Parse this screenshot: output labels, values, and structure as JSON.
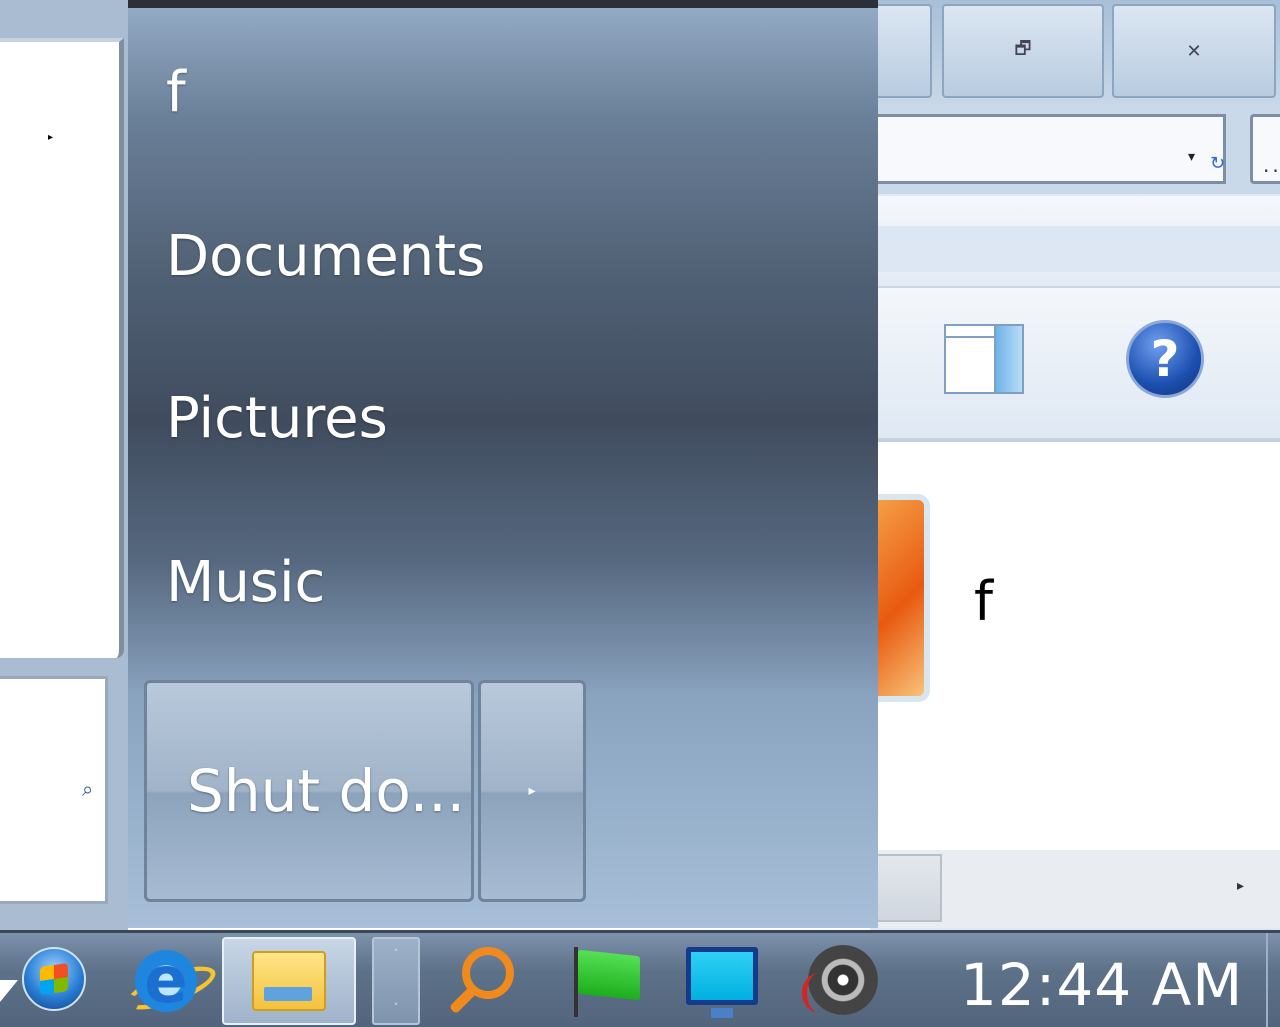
{
  "explorer": {
    "restore_icon": "restore-icon",
    "close_icon": "close-icon",
    "restore_glyph": "🗗",
    "close_glyph": "✕",
    "address_dropdown_glyph": "▾",
    "refresh_glyph": "↻",
    "search_glyph": "..",
    "help_glyph": "?",
    "file_name": "f",
    "scroll_right_glyph": "▸"
  },
  "start_menu": {
    "programs_arrow": "▸",
    "search_glyph": "⌕",
    "items": [
      {
        "label": "f"
      },
      {
        "label": "Documents"
      },
      {
        "label": "Pictures"
      },
      {
        "label": "Music"
      }
    ],
    "shutdown_label": "Shut do...",
    "shutdown_arrow": "▸"
  },
  "taskbar": {
    "pinned": [
      "start-orb",
      "internet-explorer",
      "windows-explorer",
      "search",
      "action-center-flag",
      "monitor",
      "speaker"
    ],
    "separator_up": "˄",
    "separator_down": "˅",
    "ie_glyph": "e",
    "clock": "12:44 AM"
  }
}
